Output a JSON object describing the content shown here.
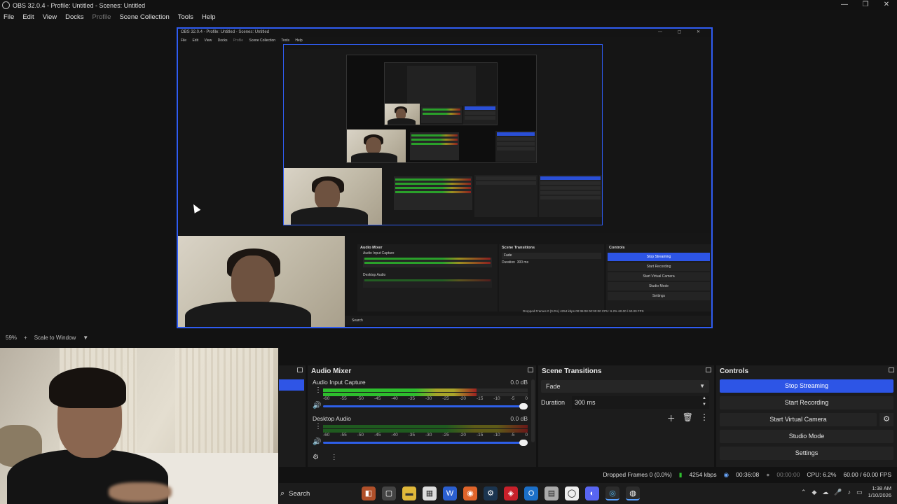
{
  "window": {
    "title": "OBS 32.0.4 - Profile: Untitled - Scenes: Untitled",
    "min": "—",
    "max": "❐",
    "close": "✕"
  },
  "menu": [
    "File",
    "Edit",
    "View",
    "Docks",
    "Profile",
    "Scene Collection",
    "Tools",
    "Help"
  ],
  "inner_window": {
    "title": "OBS 32.0.4 - Profile: Untitled - Scenes: Untitled",
    "menu": [
      "File",
      "Edit",
      "View",
      "Docks",
      "Profile",
      "Scene Collection",
      "Tools",
      "Help"
    ],
    "mixer_title": "Audio Mixer",
    "transitions_title": "Scene Transitions",
    "controls_title": "Controls",
    "controls": [
      "Stop Streaming",
      "Start Recording",
      "Start Virtual Camera",
      "Studio Mode",
      "Settings"
    ],
    "source1": "Audio Input Capture",
    "source2": "Desktop Audio",
    "fade": "Fade",
    "duration_label": "Duration",
    "duration_value": "300 ms",
    "status": "Dropped Frames 0 (0.0%)   4254 kbps   00:36:08   00:00:00   CPU: 6.2%   60.00 / 60.00 FPS",
    "search": "Search"
  },
  "zoom": {
    "level": "59%",
    "plus": "+",
    "scale": "Scale to Window"
  },
  "audio_mixer": {
    "title": "Audio Mixer",
    "sources": [
      {
        "name": "Audio Input Capture",
        "db": "0.0 dB",
        "level": 0.75
      },
      {
        "name": "Desktop Audio",
        "db": "0.0 dB",
        "level": 0
      }
    ],
    "ticks": [
      "-60",
      "-55",
      "-50",
      "-45",
      "-40",
      "-35",
      "-30",
      "-25",
      "-20",
      "-15",
      "-10",
      "-5",
      "0"
    ]
  },
  "scene_transitions": {
    "title": "Scene Transitions",
    "selected": "Fade",
    "duration_label": "Duration",
    "duration_value": "300 ms"
  },
  "controls": {
    "title": "Controls",
    "stop_streaming": "Stop Streaming",
    "start_recording": "Start Recording",
    "start_virtual_camera": "Start Virtual Camera",
    "studio_mode": "Studio Mode",
    "settings": "Settings"
  },
  "status": {
    "dropped": "Dropped Frames 0 (0.0%)",
    "bitrate": "4254 kbps",
    "stream_time": "00:36:08",
    "record_time": "00:00:00",
    "cpu": "CPU: 6.2%",
    "fps": "60.00 / 60.00 FPS"
  },
  "taskbar": {
    "search": "Search",
    "time": "1:38 AM",
    "date": "1/10/2026"
  }
}
